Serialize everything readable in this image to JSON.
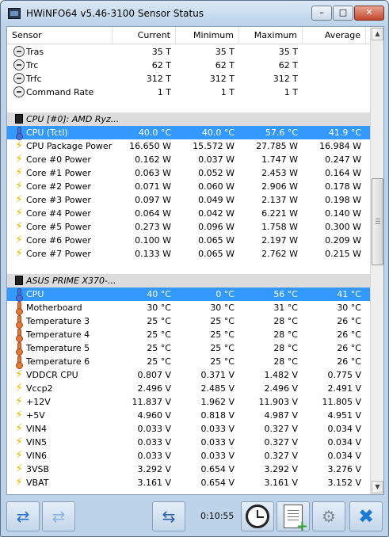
{
  "window": {
    "title": "HWiNFO64 v5.46-3100 Sensor Status"
  },
  "controls": {
    "min": "–",
    "max": "□",
    "close": "✕"
  },
  "columns": [
    "Sensor",
    "Current",
    "Minimum",
    "Maximum",
    "Average"
  ],
  "rows": [
    {
      "kind": "data",
      "icon": "clock-icon",
      "name": "Tras",
      "cur": "35 T",
      "min": "35 T",
      "max": "35 T",
      "avg": ""
    },
    {
      "kind": "data",
      "icon": "clock-icon",
      "name": "Trc",
      "cur": "62 T",
      "min": "62 T",
      "max": "62 T",
      "avg": ""
    },
    {
      "kind": "data",
      "icon": "clock-icon",
      "name": "Trfc",
      "cur": "312 T",
      "min": "312 T",
      "max": "312 T",
      "avg": ""
    },
    {
      "kind": "data",
      "icon": "clock-icon",
      "name": "Command Rate",
      "cur": "1 T",
      "min": "1 T",
      "max": "1 T",
      "avg": ""
    },
    {
      "kind": "blank"
    },
    {
      "kind": "group",
      "icon": "chip-icon",
      "name": "CPU [#0]: AMD Ryz..."
    },
    {
      "kind": "data",
      "sel": true,
      "icon": "thermometer-icon",
      "name": "CPU (Tctl)",
      "cur": "40.0 °C",
      "min": "40.0 °C",
      "max": "57.6 °C",
      "avg": "41.9 °C"
    },
    {
      "kind": "data",
      "icon": "bolt-icon",
      "name": "CPU Package Power",
      "cur": "16.650 W",
      "min": "15.572 W",
      "max": "27.785 W",
      "avg": "16.984 W"
    },
    {
      "kind": "data",
      "icon": "bolt-icon",
      "name": "Core #0 Power",
      "cur": "0.162 W",
      "min": "0.037 W",
      "max": "1.747 W",
      "avg": "0.247 W"
    },
    {
      "kind": "data",
      "icon": "bolt-icon",
      "name": "Core #1 Power",
      "cur": "0.063 W",
      "min": "0.052 W",
      "max": "2.453 W",
      "avg": "0.164 W"
    },
    {
      "kind": "data",
      "icon": "bolt-icon",
      "name": "Core #2 Power",
      "cur": "0.071 W",
      "min": "0.060 W",
      "max": "2.906 W",
      "avg": "0.178 W"
    },
    {
      "kind": "data",
      "icon": "bolt-icon",
      "name": "Core #3 Power",
      "cur": "0.097 W",
      "min": "0.049 W",
      "max": "2.137 W",
      "avg": "0.198 W"
    },
    {
      "kind": "data",
      "icon": "bolt-icon",
      "name": "Core #4 Power",
      "cur": "0.064 W",
      "min": "0.042 W",
      "max": "6.221 W",
      "avg": "0.140 W"
    },
    {
      "kind": "data",
      "icon": "bolt-icon",
      "name": "Core #5 Power",
      "cur": "0.273 W",
      "min": "0.096 W",
      "max": "1.758 W",
      "avg": "0.300 W"
    },
    {
      "kind": "data",
      "icon": "bolt-icon",
      "name": "Core #6 Power",
      "cur": "0.100 W",
      "min": "0.065 W",
      "max": "2.197 W",
      "avg": "0.209 W"
    },
    {
      "kind": "data",
      "icon": "bolt-icon",
      "name": "Core #7 Power",
      "cur": "0.133 W",
      "min": "0.065 W",
      "max": "2.762 W",
      "avg": "0.215 W"
    },
    {
      "kind": "blank"
    },
    {
      "kind": "group",
      "icon": "chip-icon",
      "name": "ASUS PRIME X370-..."
    },
    {
      "kind": "data",
      "sel": true,
      "icon": "thermometer-icon",
      "name": "CPU",
      "cur": "40 °C",
      "min": "0 °C",
      "max": "56 °C",
      "avg": "41 °C"
    },
    {
      "kind": "data",
      "icon": "thermometer-hot-icon",
      "name": "Motherboard",
      "cur": "30 °C",
      "min": "30 °C",
      "max": "31 °C",
      "avg": "30 °C"
    },
    {
      "kind": "data",
      "icon": "thermometer-hot-icon",
      "name": "Temperature 3",
      "cur": "25 °C",
      "min": "25 °C",
      "max": "28 °C",
      "avg": "26 °C"
    },
    {
      "kind": "data",
      "icon": "thermometer-hot-icon",
      "name": "Temperature 4",
      "cur": "25 °C",
      "min": "25 °C",
      "max": "28 °C",
      "avg": "26 °C"
    },
    {
      "kind": "data",
      "icon": "thermometer-hot-icon",
      "name": "Temperature 5",
      "cur": "25 °C",
      "min": "25 °C",
      "max": "28 °C",
      "avg": "26 °C"
    },
    {
      "kind": "data",
      "icon": "thermometer-hot-icon",
      "name": "Temperature 6",
      "cur": "25 °C",
      "min": "25 °C",
      "max": "28 °C",
      "avg": "26 °C"
    },
    {
      "kind": "data",
      "icon": "bolt-icon",
      "name": "VDDCR CPU",
      "cur": "0.807 V",
      "min": "0.371 V",
      "max": "1.482 V",
      "avg": "0.775 V"
    },
    {
      "kind": "data",
      "icon": "bolt-icon",
      "name": "Vccp2",
      "cur": "2.496 V",
      "min": "2.485 V",
      "max": "2.496 V",
      "avg": "2.491 V"
    },
    {
      "kind": "data",
      "icon": "bolt-icon",
      "name": "+12V",
      "cur": "11.837 V",
      "min": "1.962 V",
      "max": "11.903 V",
      "avg": "11.805 V"
    },
    {
      "kind": "data",
      "icon": "bolt-icon",
      "name": "+5V",
      "cur": "4.960 V",
      "min": "0.818 V",
      "max": "4.987 V",
      "avg": "4.951 V"
    },
    {
      "kind": "data",
      "icon": "bolt-icon",
      "name": "VIN4",
      "cur": "0.033 V",
      "min": "0.033 V",
      "max": "0.327 V",
      "avg": "0.034 V"
    },
    {
      "kind": "data",
      "icon": "bolt-icon",
      "name": "VIN5",
      "cur": "0.033 V",
      "min": "0.033 V",
      "max": "0.327 V",
      "avg": "0.034 V"
    },
    {
      "kind": "data",
      "icon": "bolt-icon",
      "name": "VIN6",
      "cur": "0.033 V",
      "min": "0.033 V",
      "max": "0.327 V",
      "avg": "0.034 V"
    },
    {
      "kind": "data",
      "icon": "bolt-icon",
      "name": "3VSB",
      "cur": "3.292 V",
      "min": "0.654 V",
      "max": "3.292 V",
      "avg": "3.276 V"
    },
    {
      "kind": "data",
      "icon": "bolt-icon",
      "name": "VBAT",
      "cur": "3.161 V",
      "min": "0.654 V",
      "max": "3.161 V",
      "avg": "3.152 V"
    }
  ],
  "toolbar": {
    "prev_icon": "⇄",
    "next_icon": "⇄",
    "network_icon": "⇆",
    "timer": "0:10:55",
    "close_icon": "✖"
  }
}
